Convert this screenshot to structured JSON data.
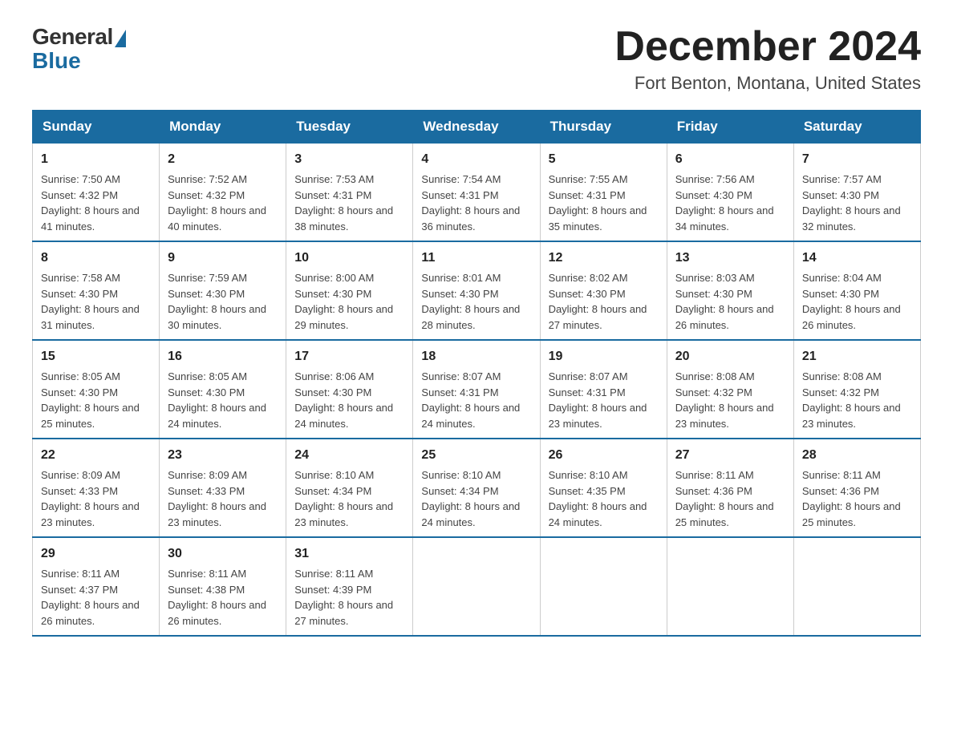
{
  "header": {
    "logo_general": "General",
    "logo_blue": "Blue",
    "month_title": "December 2024",
    "location": "Fort Benton, Montana, United States"
  },
  "days_of_week": [
    "Sunday",
    "Monday",
    "Tuesday",
    "Wednesday",
    "Thursday",
    "Friday",
    "Saturday"
  ],
  "weeks": [
    [
      {
        "num": "1",
        "sunrise": "7:50 AM",
        "sunset": "4:32 PM",
        "daylight": "8 hours and 41 minutes."
      },
      {
        "num": "2",
        "sunrise": "7:52 AM",
        "sunset": "4:32 PM",
        "daylight": "8 hours and 40 minutes."
      },
      {
        "num": "3",
        "sunrise": "7:53 AM",
        "sunset": "4:31 PM",
        "daylight": "8 hours and 38 minutes."
      },
      {
        "num": "4",
        "sunrise": "7:54 AM",
        "sunset": "4:31 PM",
        "daylight": "8 hours and 36 minutes."
      },
      {
        "num": "5",
        "sunrise": "7:55 AM",
        "sunset": "4:31 PM",
        "daylight": "8 hours and 35 minutes."
      },
      {
        "num": "6",
        "sunrise": "7:56 AM",
        "sunset": "4:30 PM",
        "daylight": "8 hours and 34 minutes."
      },
      {
        "num": "7",
        "sunrise": "7:57 AM",
        "sunset": "4:30 PM",
        "daylight": "8 hours and 32 minutes."
      }
    ],
    [
      {
        "num": "8",
        "sunrise": "7:58 AM",
        "sunset": "4:30 PM",
        "daylight": "8 hours and 31 minutes."
      },
      {
        "num": "9",
        "sunrise": "7:59 AM",
        "sunset": "4:30 PM",
        "daylight": "8 hours and 30 minutes."
      },
      {
        "num": "10",
        "sunrise": "8:00 AM",
        "sunset": "4:30 PM",
        "daylight": "8 hours and 29 minutes."
      },
      {
        "num": "11",
        "sunrise": "8:01 AM",
        "sunset": "4:30 PM",
        "daylight": "8 hours and 28 minutes."
      },
      {
        "num": "12",
        "sunrise": "8:02 AM",
        "sunset": "4:30 PM",
        "daylight": "8 hours and 27 minutes."
      },
      {
        "num": "13",
        "sunrise": "8:03 AM",
        "sunset": "4:30 PM",
        "daylight": "8 hours and 26 minutes."
      },
      {
        "num": "14",
        "sunrise": "8:04 AM",
        "sunset": "4:30 PM",
        "daylight": "8 hours and 26 minutes."
      }
    ],
    [
      {
        "num": "15",
        "sunrise": "8:05 AM",
        "sunset": "4:30 PM",
        "daylight": "8 hours and 25 minutes."
      },
      {
        "num": "16",
        "sunrise": "8:05 AM",
        "sunset": "4:30 PM",
        "daylight": "8 hours and 24 minutes."
      },
      {
        "num": "17",
        "sunrise": "8:06 AM",
        "sunset": "4:30 PM",
        "daylight": "8 hours and 24 minutes."
      },
      {
        "num": "18",
        "sunrise": "8:07 AM",
        "sunset": "4:31 PM",
        "daylight": "8 hours and 24 minutes."
      },
      {
        "num": "19",
        "sunrise": "8:07 AM",
        "sunset": "4:31 PM",
        "daylight": "8 hours and 23 minutes."
      },
      {
        "num": "20",
        "sunrise": "8:08 AM",
        "sunset": "4:32 PM",
        "daylight": "8 hours and 23 minutes."
      },
      {
        "num": "21",
        "sunrise": "8:08 AM",
        "sunset": "4:32 PM",
        "daylight": "8 hours and 23 minutes."
      }
    ],
    [
      {
        "num": "22",
        "sunrise": "8:09 AM",
        "sunset": "4:33 PM",
        "daylight": "8 hours and 23 minutes."
      },
      {
        "num": "23",
        "sunrise": "8:09 AM",
        "sunset": "4:33 PM",
        "daylight": "8 hours and 23 minutes."
      },
      {
        "num": "24",
        "sunrise": "8:10 AM",
        "sunset": "4:34 PM",
        "daylight": "8 hours and 23 minutes."
      },
      {
        "num": "25",
        "sunrise": "8:10 AM",
        "sunset": "4:34 PM",
        "daylight": "8 hours and 24 minutes."
      },
      {
        "num": "26",
        "sunrise": "8:10 AM",
        "sunset": "4:35 PM",
        "daylight": "8 hours and 24 minutes."
      },
      {
        "num": "27",
        "sunrise": "8:11 AM",
        "sunset": "4:36 PM",
        "daylight": "8 hours and 25 minutes."
      },
      {
        "num": "28",
        "sunrise": "8:11 AM",
        "sunset": "4:36 PM",
        "daylight": "8 hours and 25 minutes."
      }
    ],
    [
      {
        "num": "29",
        "sunrise": "8:11 AM",
        "sunset": "4:37 PM",
        "daylight": "8 hours and 26 minutes."
      },
      {
        "num": "30",
        "sunrise": "8:11 AM",
        "sunset": "4:38 PM",
        "daylight": "8 hours and 26 minutes."
      },
      {
        "num": "31",
        "sunrise": "8:11 AM",
        "sunset": "4:39 PM",
        "daylight": "8 hours and 27 minutes."
      },
      null,
      null,
      null,
      null
    ]
  ]
}
